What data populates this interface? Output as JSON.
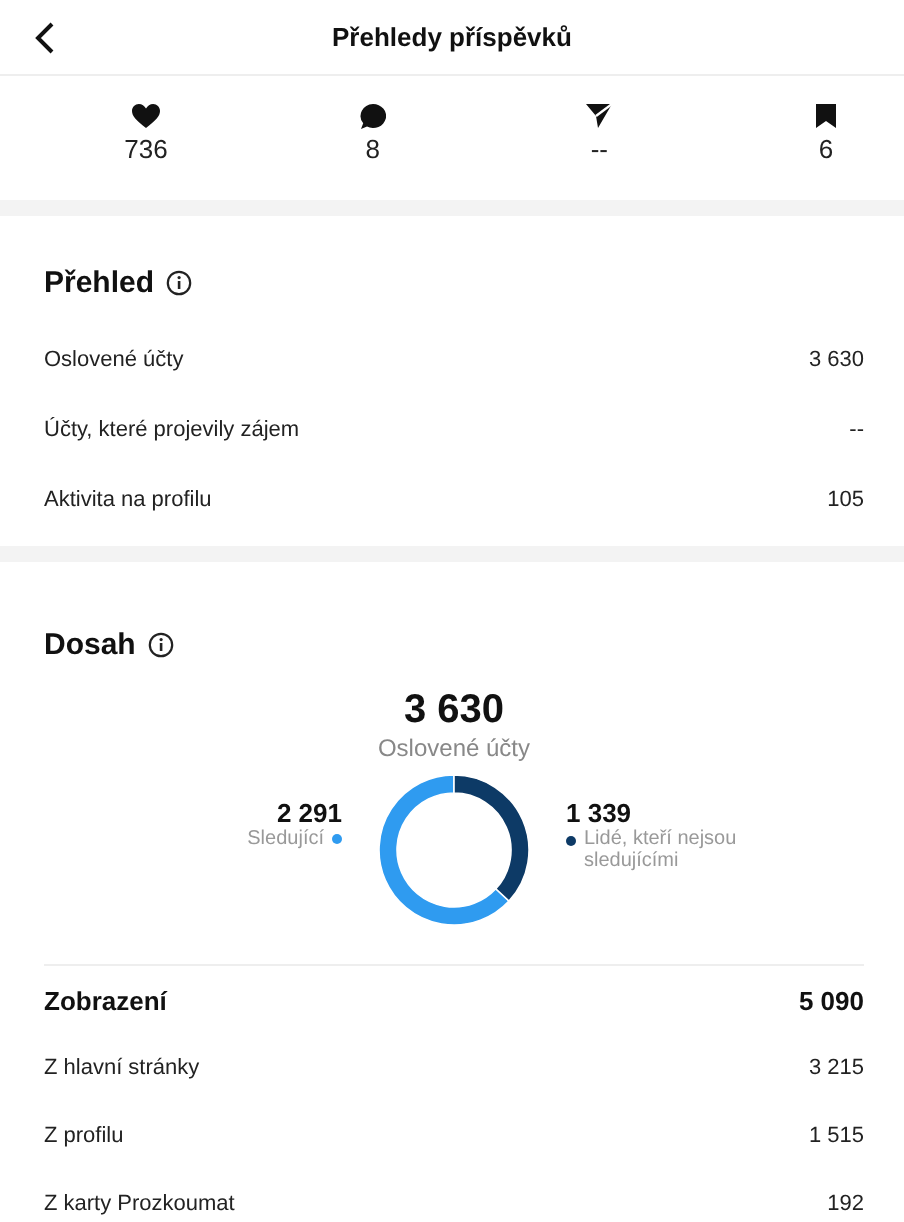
{
  "header": {
    "title": "Přehledy příspěvků"
  },
  "stats": [
    {
      "kind": "likes",
      "value": "736"
    },
    {
      "kind": "comments",
      "value": "8"
    },
    {
      "kind": "shares",
      "value": "--"
    },
    {
      "kind": "saves",
      "value": "6"
    }
  ],
  "overview": {
    "title": "Přehled",
    "info_icon": true,
    "rows": [
      {
        "label": "Oslovené účty",
        "value": "3 630"
      },
      {
        "label": "Účty, které projevily zájem",
        "value": "--"
      },
      {
        "label": "Aktivita na profilu",
        "value": "105"
      }
    ]
  },
  "reach": {
    "title": "Dosah",
    "info_icon": true,
    "total": "3 630",
    "total_label": "Oslovené účty",
    "segments": [
      {
        "value": "2 291",
        "label": "Sledující",
        "color": "#2f9bf0"
      },
      {
        "value": "1 339",
        "label": "Lidé, kteří nejsou sledujícími",
        "color": "#0d3a66"
      }
    ],
    "chart_data": {
      "type": "donut",
      "values": [
        63.1,
        36.9
      ]
    }
  },
  "impressions": {
    "title": "Zobrazení",
    "total": "5 090",
    "rows": [
      {
        "label": "Z hlavní stránky",
        "value": "3 215"
      },
      {
        "label": "Z profilu",
        "value": "1 515"
      },
      {
        "label": "Z karty Prozkoumat",
        "value": "192"
      }
    ]
  }
}
